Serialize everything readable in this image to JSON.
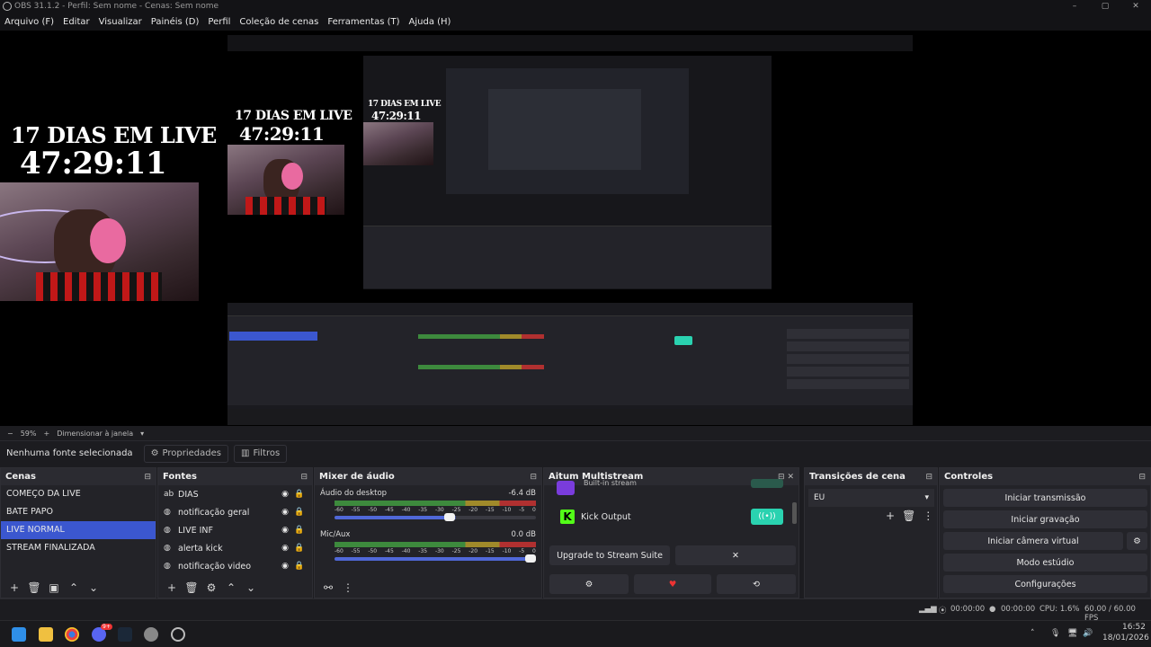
{
  "window": {
    "title": "OBS 31.1.2 - Perfil: Sem nome - Cenas: Sem nome",
    "controls": [
      "–",
      "▢",
      "✕"
    ]
  },
  "menu": [
    "Arquivo (F)",
    "Editar",
    "Visualizar",
    "Painéis (D)",
    "Perfil",
    "Coleção de cenas",
    "Ferramentas (T)",
    "Ajuda (H)"
  ],
  "preview": {
    "overlay_line1": "17 DIAS EM LIVE",
    "overlay_line2": "47:29:11"
  },
  "status_row": {
    "zoom": "59%",
    "resize_label": "Dimensionar à janela"
  },
  "source_bar": {
    "no_source": "Nenhuma fonte selecionada",
    "properties": "Propriedades",
    "filters": "Filtros"
  },
  "scenes": {
    "title": "Cenas",
    "items": [
      "COMEÇO DA LIVE",
      "BATE PAPO",
      "LIVE NORMAL",
      "STREAM FINALIZADA"
    ],
    "selected": 2
  },
  "sources": {
    "title": "Fontes",
    "items": [
      {
        "name": "DIAS",
        "icon": "text-icon"
      },
      {
        "name": "notificação geral",
        "icon": "browser-icon"
      },
      {
        "name": "LIVE INF",
        "icon": "browser-icon"
      },
      {
        "name": "alerta kick",
        "icon": "browser-icon"
      },
      {
        "name": "notificação video",
        "icon": "browser-icon"
      }
    ]
  },
  "mixer": {
    "title": "Mixer de áudio",
    "ticks": [
      "-60",
      "-55",
      "-50",
      "-45",
      "-40",
      "-35",
      "-30",
      "-25",
      "-20",
      "-15",
      "-10",
      "-5",
      "0"
    ],
    "channels": [
      {
        "name": "Áudio do desktop",
        "db": "-6.4 dB",
        "level": 0.6
      },
      {
        "name": "Mic/Aux",
        "db": "0.0 dB",
        "level": 1.0
      }
    ]
  },
  "multistream": {
    "title": "Aitum Multistream",
    "built_in": "Built-in stream",
    "kick": "Kick Output",
    "upgrade": "Upgrade to Stream Suite",
    "close": "✕"
  },
  "transitions": {
    "title": "Transições de cena",
    "selected": "EU"
  },
  "controls": {
    "title": "Controles",
    "buttons": [
      "Iniciar transmissão",
      "Iniciar gravação",
      "Iniciar câmera virtual",
      "Modo estúdio",
      "Configurações"
    ]
  },
  "statusbar": {
    "stream_time": "00:00:00",
    "rec_time": "00:00:00",
    "cpu": "CPU: 1.6%",
    "fps": "60.00 / 60.00 FPS"
  },
  "taskbar": {
    "time": "16:52",
    "date": "18/01/2026",
    "discord_badge": "9+"
  },
  "colors": {
    "accent": "#3b57cf",
    "kick_green": "#53fc18",
    "live_teal": "#2ad2b0"
  }
}
